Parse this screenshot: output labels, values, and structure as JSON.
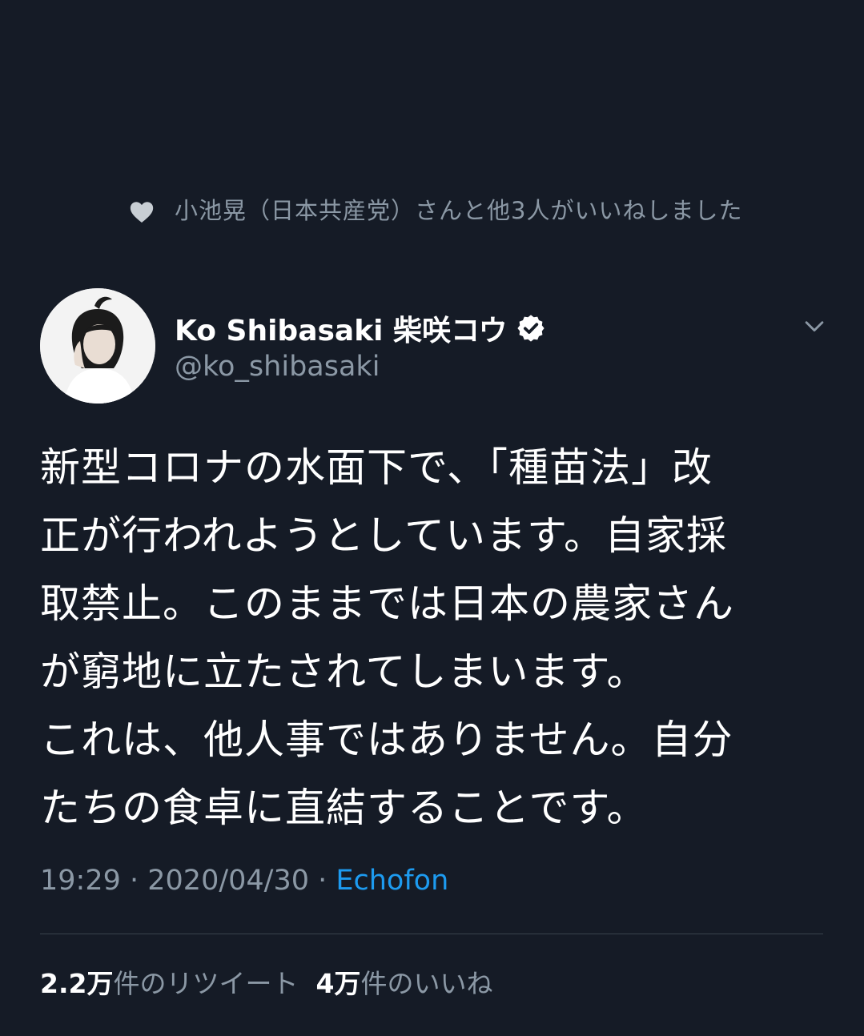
{
  "social_context": {
    "text": "小池晃（日本共産党）さんと他3人がいいねしました",
    "icon": "heart-icon"
  },
  "author": {
    "display_name": "Ko Shibasaki 柴咲コウ",
    "handle": "@ko_shibasaki",
    "verified": true
  },
  "tweet": {
    "lines": [
      "新型コロナの水面下で、「種苗法」改",
      "正が行われようとしています。自家採",
      "取禁止。このままでは日本の農家さん",
      "が窮地に立たされてしまいます。",
      "これは、他人事ではありません。自分",
      "たちの食卓に直結することです。"
    ]
  },
  "meta": {
    "time": "19:29",
    "separator": " · ",
    "date": "2020/04/30",
    "source": "Echofon"
  },
  "stats": {
    "retweets_count": "2.2万",
    "retweets_label": "件のリツイート",
    "likes_count": "4万",
    "likes_label": "件のいいね"
  },
  "colors": {
    "background": "#151b26",
    "secondary_text": "#8b98a5",
    "link": "#1d9bf0"
  }
}
